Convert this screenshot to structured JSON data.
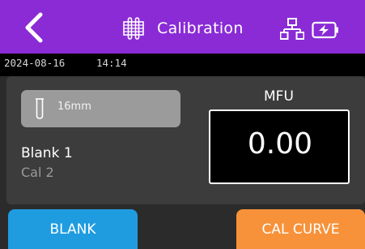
{
  "header": {
    "title": "Calibration",
    "back_icon": "chevron-left-icon",
    "title_icon": "sample-rack-icon",
    "network_icon": "network-icon",
    "battery_icon": "battery-charging-icon",
    "color": "#8a2bd6"
  },
  "status": {
    "date": "2024-08-16",
    "time": "14:14"
  },
  "main": {
    "tube": {
      "label": "16mm",
      "icon": "test-tube-icon"
    },
    "items": {
      "active": "Blank 1",
      "next": "Cal 2"
    },
    "reading": {
      "unit": "MFU",
      "value": "0.00"
    }
  },
  "buttons": {
    "blank": "BLANK",
    "cal_curve": "CAL CURVE",
    "blank_color": "#1f9ce0",
    "cal_color": "#f7923a"
  }
}
